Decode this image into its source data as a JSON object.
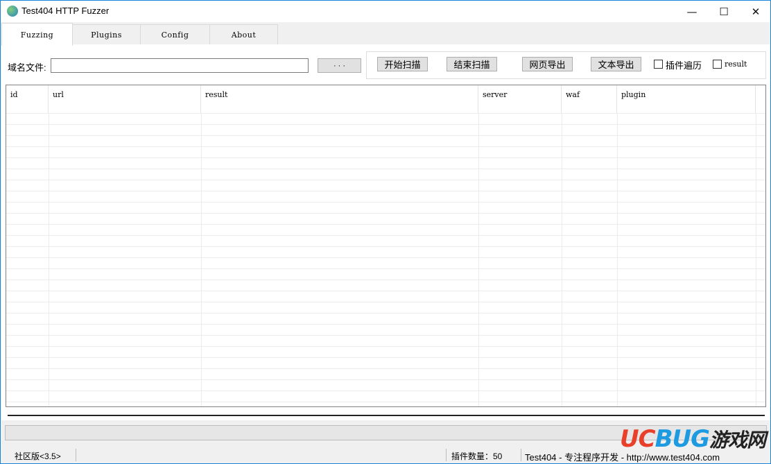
{
  "window": {
    "title": "Test404 HTTP Fuzzer",
    "minimize": "—",
    "maximize": "☐",
    "close": "✕"
  },
  "tabs": [
    {
      "label": "Fuzzing",
      "active": true
    },
    {
      "label": "Plugins"
    },
    {
      "label": "Config"
    },
    {
      "label": "About"
    }
  ],
  "form": {
    "domain_file_label": "域名文件:",
    "domain_file_value": "",
    "browse_label": "· · ·"
  },
  "actions": {
    "start_scan": "开始扫描",
    "stop_scan": "结束扫描",
    "export_html": "网页导出",
    "export_text": "文本导出",
    "plugin_traverse": "插件遍历",
    "plugin_traverse_checked": false,
    "result": "result",
    "result_checked": false
  },
  "table": {
    "columns": [
      "id",
      "url",
      "result",
      "server",
      "waf",
      "plugin"
    ],
    "rows": []
  },
  "progress": {
    "value": 0
  },
  "status": {
    "edition": "社区版<3.5>",
    "plugin_count": "插件数量：50",
    "credit": "Test404 - 专注程序开发 - http://www.test404.com"
  },
  "watermark": {
    "text": "UCBUG游戏网 .com",
    "colors": {
      "uc": "#e8402a",
      "bug": "#1e9be0"
    }
  }
}
